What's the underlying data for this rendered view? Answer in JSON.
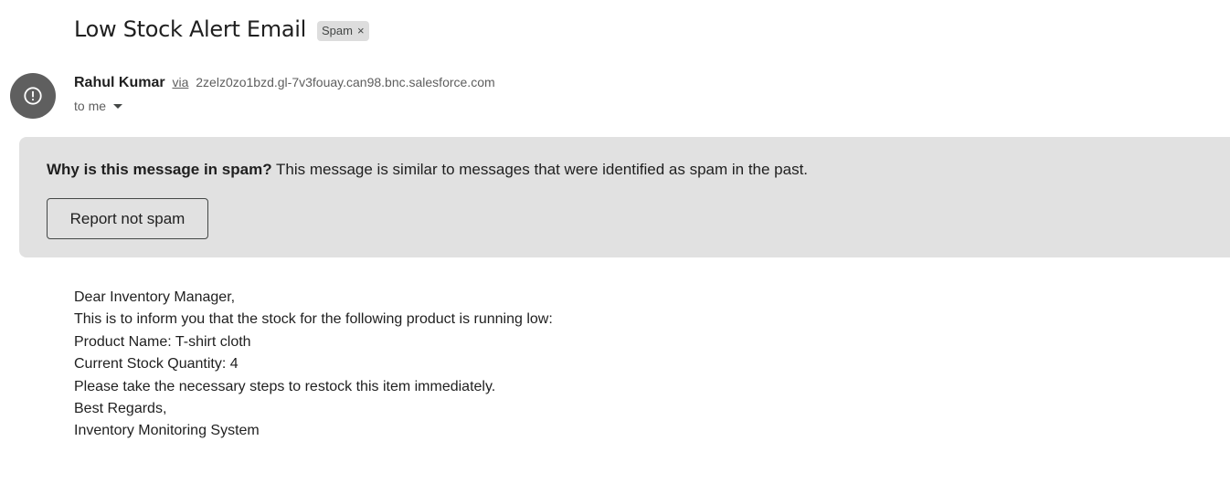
{
  "email": {
    "subject": "Low Stock Alert Email",
    "label": "Spam",
    "label_remove": "×",
    "sender_name": "Rahul Kumar",
    "via": "via",
    "via_domain": "2zelz0zo1bzd.gl-7v3fouay.can98.bnc.salesforce.com",
    "recipient": "to me",
    "avatar_icon": "warning-circle-icon"
  },
  "spam_banner": {
    "question": "Why is this message in spam?",
    "explanation": " This message is similar to messages that were identified as spam in the past.",
    "button_label": "Report not spam",
    "background": "#e1e1e1"
  },
  "body": {
    "lines": [
      "Dear Inventory Manager,",
      "This is to inform you that the stock for the following product is running low:",
      "Product Name: T-shirt cloth",
      "Current Stock Quantity: 4",
      "Please take the necessary steps to restock this item immediately.",
      "Best Regards,",
      "Inventory Monitoring System"
    ]
  }
}
